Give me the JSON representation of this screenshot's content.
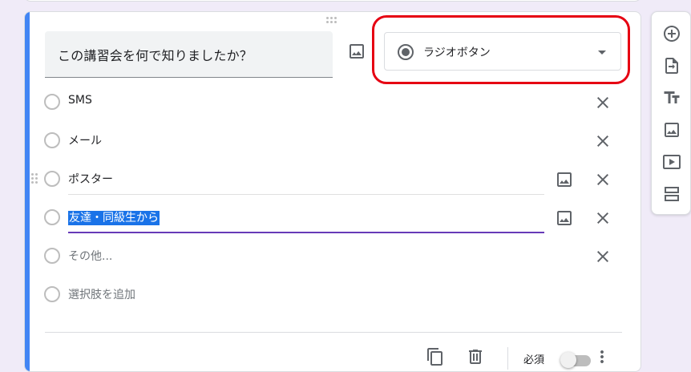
{
  "question": {
    "title": "この講習会を何で知りましたか？",
    "type_label": "ラジオボタン",
    "options": [
      {
        "label": "SMS"
      },
      {
        "label": "メール"
      },
      {
        "label": "ポスター"
      },
      {
        "label": "友達・同級生から"
      },
      {
        "label": "その他..."
      },
      {
        "label": "選択肢を追加"
      }
    ]
  },
  "footer": {
    "required_label": "必須"
  },
  "toolbar": {
    "items": [
      {
        "icon": "add-circle-icon"
      },
      {
        "icon": "import-question-icon"
      },
      {
        "icon": "title-text-icon"
      },
      {
        "icon": "image-icon"
      },
      {
        "icon": "video-icon"
      },
      {
        "icon": "section-icon"
      }
    ]
  },
  "colors": {
    "accent": "#4285f4",
    "highlight": "#e60012",
    "focus_underline": "#673ab7",
    "selection": "#1a73e8"
  }
}
